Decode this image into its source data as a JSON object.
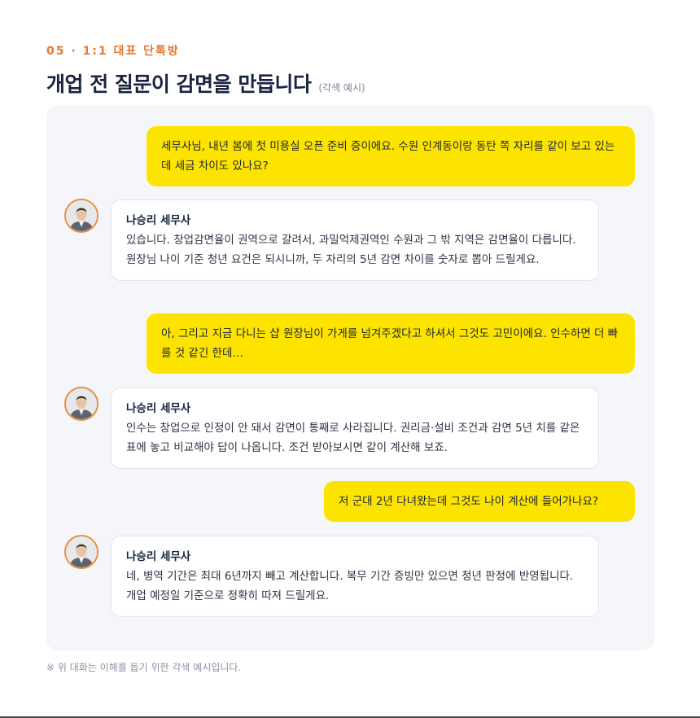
{
  "section": {
    "eyebrow": "05 · 1:1 대표 단톡방",
    "title": "개업 전 질문이 감면을 만듭니다",
    "title_note": "(각색 예시)"
  },
  "chat": {
    "messages": [
      {
        "role": "user",
        "text": "세무사님, 내년 봄에 첫 미용실 오픈 준비 중이에요. 수원 인계동이랑 동탄 쪽 자리를 같이 보고 있는데 세금 차이도 있나요?"
      },
      {
        "role": "advisor",
        "sender": "나승리 세무사",
        "text": "있습니다. 창업감면율이 권역으로 갈려서, 과밀억제권역인 수원과 그 밖 지역은 감면율이 다릅니다. 원장님 나이 기준 청년 요건은 되시니까, 두 자리의 5년 감면 차이를 숫자로 뽑아 드릴게요."
      },
      {
        "role": "user",
        "text": "아, 그리고 지금 다니는 샵 원장님이 가게를 넘겨주겠다고 하셔서 그것도 고민이에요. 인수하면 더 빠를 것 같긴 한데…"
      },
      {
        "role": "advisor",
        "sender": "나승리 세무사",
        "text": "인수는 창업으로 인정이 안 돼서 감면이 통째로 사라집니다. 권리금·설비 조건과 감면 5년 치를 같은 표에 놓고 비교해야 답이 나옵니다. 조건 받아보시면 같이 계산해 보죠."
      },
      {
        "role": "user",
        "text": "저 군대 2년 다녀왔는데 그것도 나이 계산에 들어가나요?"
      },
      {
        "role": "advisor",
        "sender": "나승리 세무사",
        "text": "네, 병역 기간은 최대 6년까지 빼고 계산합니다. 복무 기간 증빙만 있으면 청년 판정에 반영됩니다. 개업 예정일 기준으로 정확히 따져 드릴게요."
      }
    ]
  },
  "footnote": "※ 위 대화는 이해를 돕기 위한 각색 예시입니다.",
  "colors": {
    "accent": "#e8772e",
    "user_bubble": "#fde400",
    "panel": "#f5f6fa",
    "title": "#1a2340"
  }
}
